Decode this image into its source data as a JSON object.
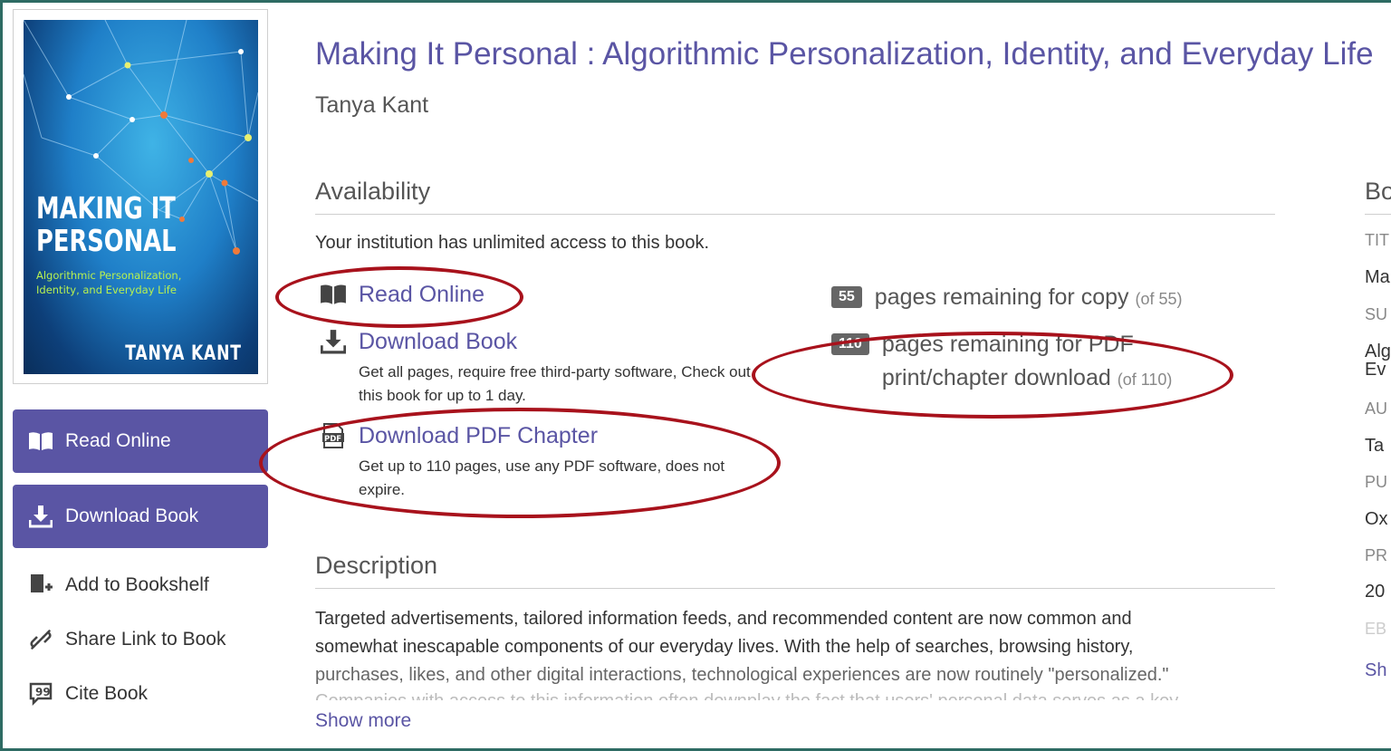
{
  "book": {
    "title": "Making It Personal : Algorithmic Personalization, Identity, and Everyday Life",
    "author": "Tanya Kant",
    "cover": {
      "title_line1": "MAKING IT",
      "title_line2": "PERSONAL",
      "subtitle": "Algorithmic Personalization, Identity, and Everyday Life",
      "author": "TANYA KANT"
    }
  },
  "sidebar": {
    "read_online": "Read Online",
    "download_book": "Download Book",
    "add_to_bookshelf": "Add to Bookshelf",
    "share_link": "Share Link to Book",
    "cite_book": "Cite Book"
  },
  "availability": {
    "heading": "Availability",
    "note": "Your institution has unlimited access to this book.",
    "read_online": "Read Online",
    "download_book": "Download Book",
    "download_book_desc": "Get all pages, require free third-party software, Check out this book for up to 1 day.",
    "download_pdf": "Download PDF Chapter",
    "download_pdf_desc": "Get up to 110 pages, use any PDF software, does not expire.",
    "copy": {
      "badge": "55",
      "text": "pages remaining for copy",
      "of": "(of 55)"
    },
    "pdf": {
      "badge": "110",
      "text_line1": "pages remaining for PDF",
      "text_line2": "print/chapter download",
      "of": "(of 110)"
    }
  },
  "description": {
    "heading": "Description",
    "line1": "Targeted advertisements, tailored information feeds, and recommended content are now common and",
    "line2": "somewhat inescapable components of our everyday lives. With the help of searches, browsing history,",
    "line3": "purchases, likes, and other digital interactions, technological experiences are now routinely \"personalized.\"",
    "line4": "Companies with access to this information often downplay the fact that users' personal data serves as a key",
    "show_more": "Show more"
  },
  "details_clipped": {
    "heading": "Bo",
    "title_label": "TIT",
    "title_val": "Ma",
    "subtitle_label": "SU",
    "subtitle_val1": "Alg",
    "subtitle_val2": "Ev",
    "author_label": "AU",
    "author_val": "Ta",
    "publisher_label": "PU",
    "publisher_val": "Ox",
    "published_label": "PR",
    "published_val": "20",
    "ebook_label": "EB",
    "show_link": "Sh"
  },
  "colors": {
    "accent": "#5a55a4",
    "highlight_ellipse": "#a8121c",
    "frame": "#2e6b63",
    "badge": "#666666"
  }
}
